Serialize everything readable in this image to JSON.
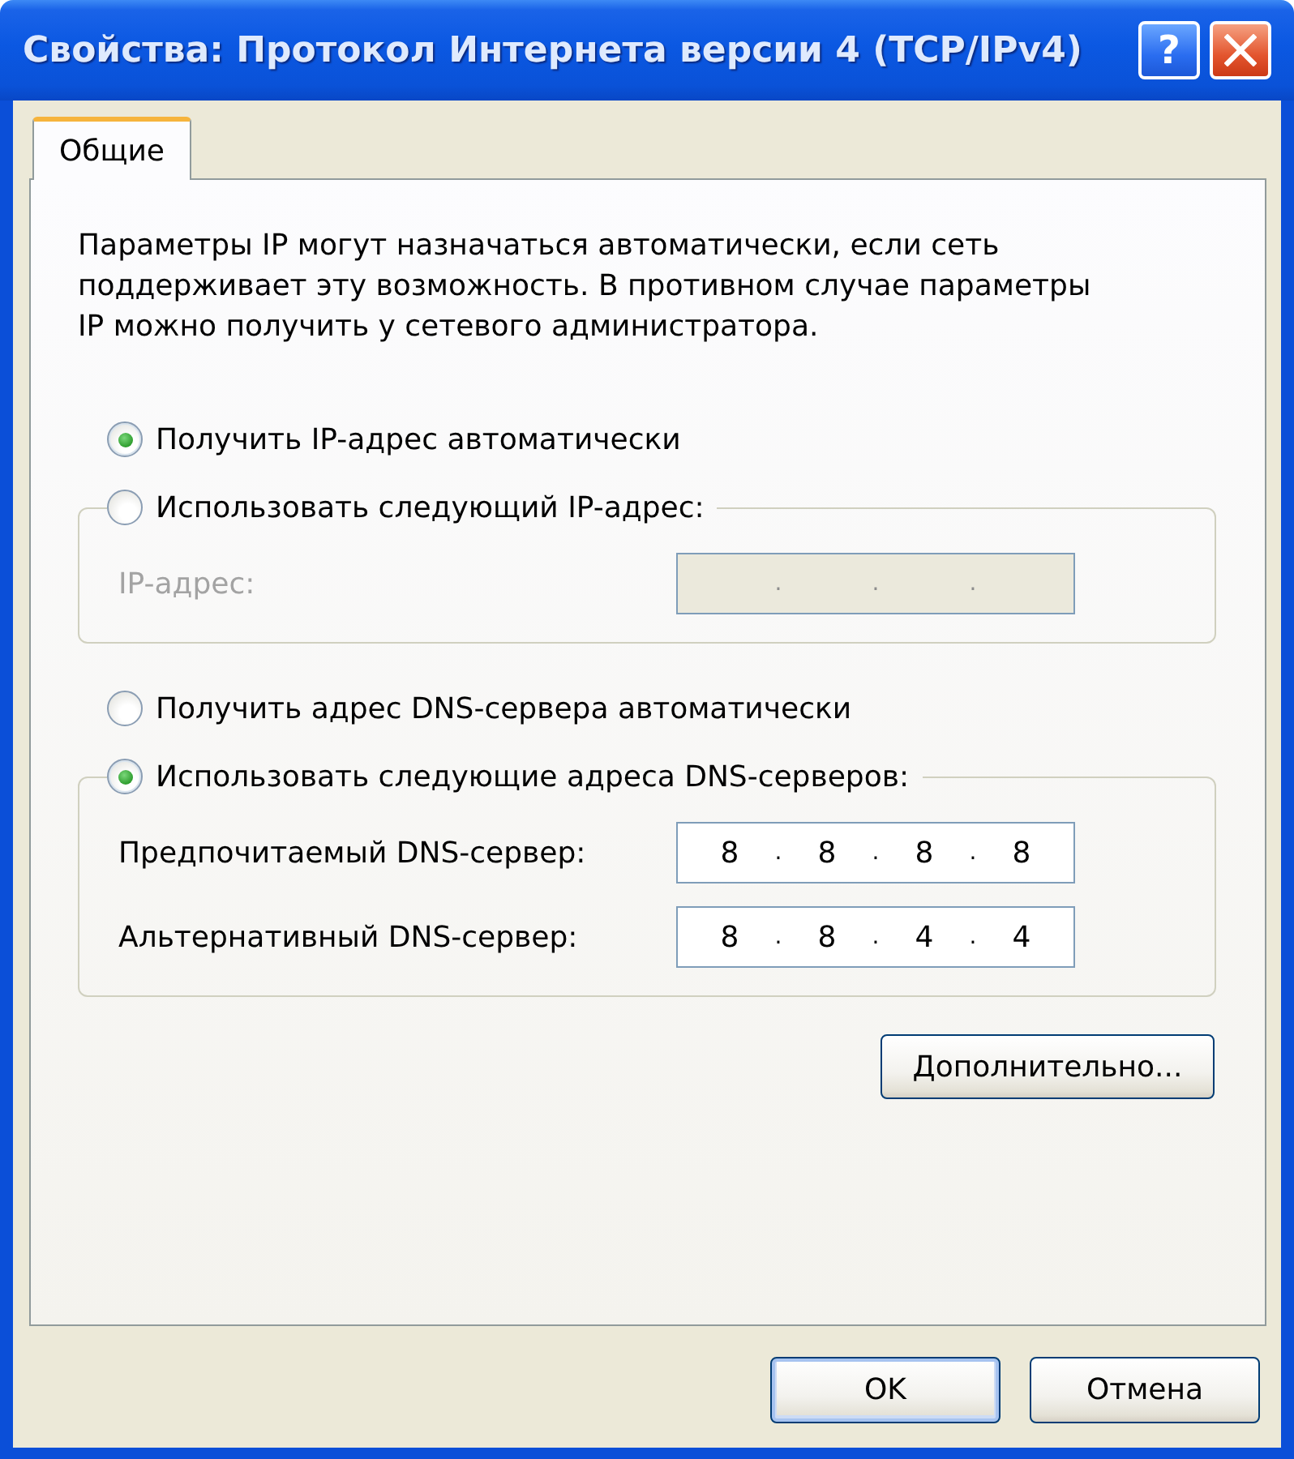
{
  "window": {
    "title": "Свойства: Протокол Интернета версии 4 (TCP/IPv4)",
    "controls": [
      {
        "kind": "help",
        "label": "?"
      },
      {
        "kind": "close"
      }
    ]
  },
  "tabs": [
    {
      "label": "Общие",
      "selected": true
    }
  ],
  "intro": "Параметры IP могут назначаться автоматически, если сеть поддерживает эту возможность. В противном случае параметры IP можно получить у сетевого администратора.",
  "ip_address": {
    "options": [
      {
        "label": "Получить IP-адрес автоматически",
        "selected": true
      },
      {
        "label": "Использовать следующий IP-адрес:",
        "selected": false
      }
    ],
    "fields": [
      {
        "label": "IP-адрес:",
        "disabled": true,
        "separators": [
          ".",
          ".",
          "."
        ]
      }
    ]
  },
  "dns": {
    "options": [
      {
        "label": "Получить адрес DNS-сервера автоматически",
        "selected": false
      },
      {
        "label": "Использовать следующие адреса DNS-серверов:",
        "selected": true
      }
    ],
    "fields": [
      {
        "label": "Предпочитаемый DNS-сервер:",
        "disabled": false,
        "octets": [
          "8",
          "8",
          "8",
          "8"
        ],
        "separators": [
          ".",
          ".",
          "."
        ]
      },
      {
        "label": "Альтернативный DNS-сервер:",
        "disabled": false,
        "octets": [
          "8",
          "8",
          "4",
          "4"
        ],
        "separators": [
          ".",
          ".",
          "."
        ]
      }
    ]
  },
  "advanced_button": "Дополнительно...",
  "buttons": [
    {
      "label": "OK",
      "default": true
    },
    {
      "label": "Отмена",
      "default": false
    }
  ]
}
